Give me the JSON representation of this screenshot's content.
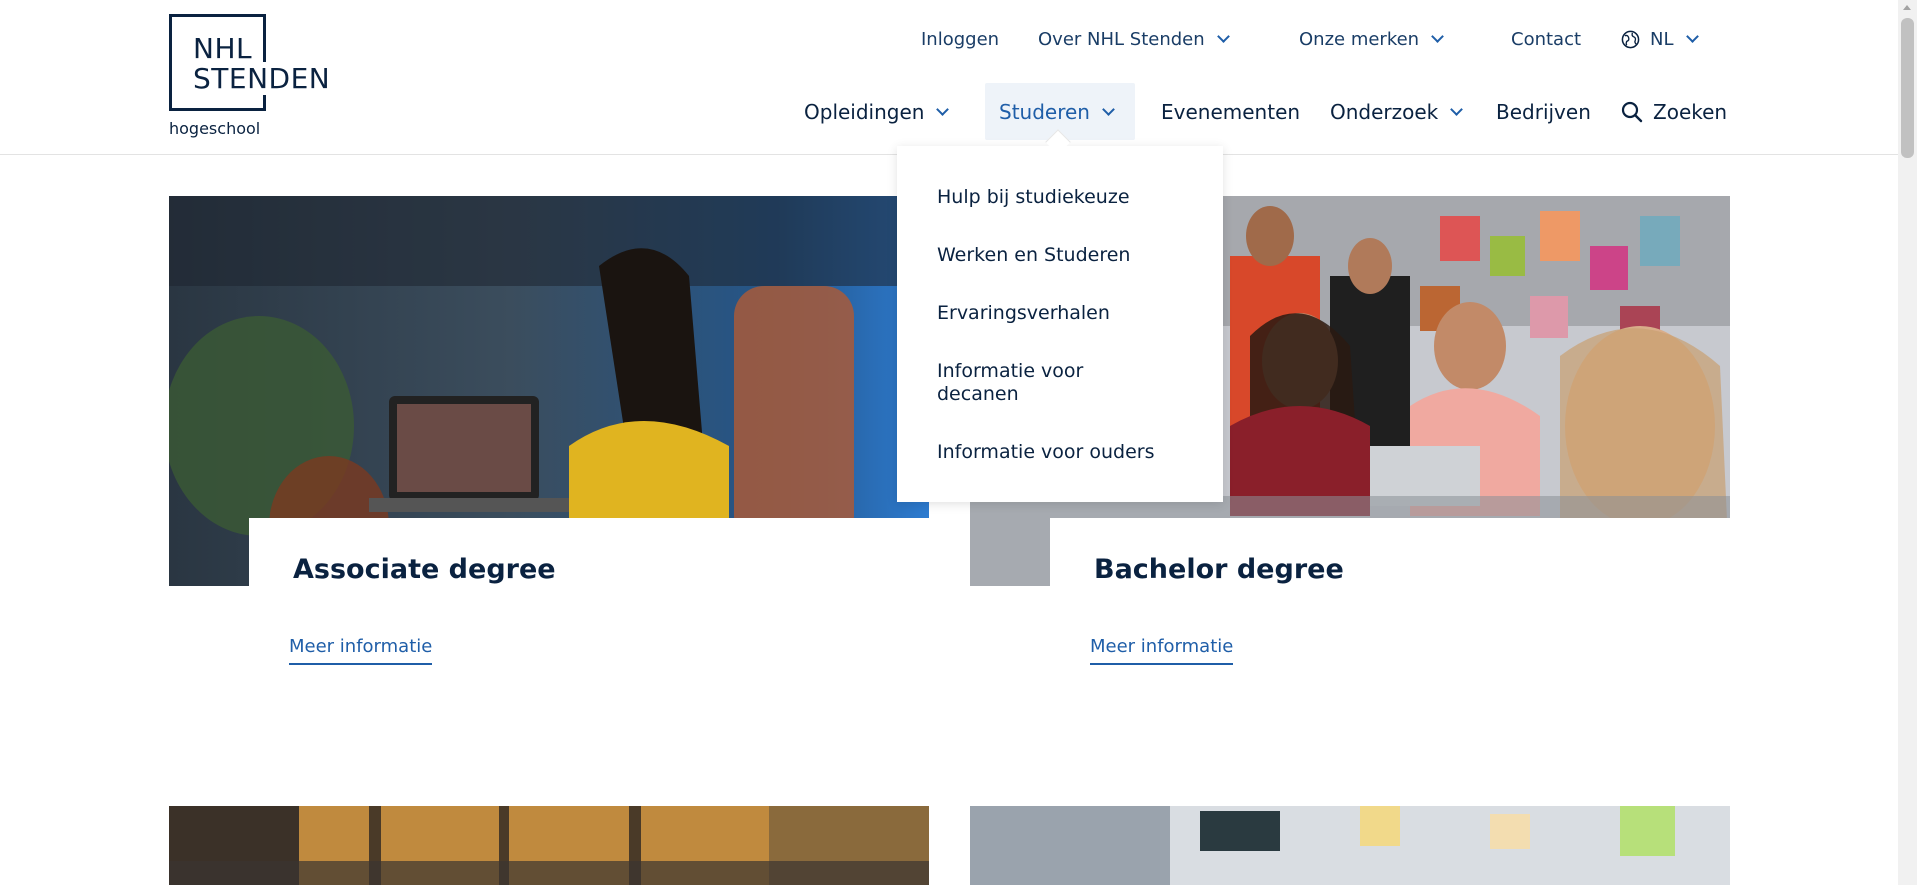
{
  "logo": {
    "line1": "NHL",
    "line2": "STENDEN",
    "subtitle": "hogeschool"
  },
  "top_nav": {
    "login": "Inloggen",
    "about": "Over NHL Stenden",
    "brands": "Onze merken",
    "contact": "Contact",
    "language": "NL"
  },
  "main_nav": {
    "programs": "Opleidingen",
    "studying": "Studeren",
    "events": "Evenementen",
    "research": "Onderzoek",
    "companies": "Bedrijven",
    "search": "Zoeken"
  },
  "dropdown": {
    "items": [
      "Hulp bij studiekeuze",
      "Werken en Studeren",
      "Ervaringsverhalen",
      "Informatie voor decanen",
      "Informatie voor ouders"
    ]
  },
  "cards": [
    {
      "title": "Associate degree",
      "link": "Meer informatie"
    },
    {
      "title": "Bachelor degree",
      "link": "Meer informatie"
    }
  ],
  "colors": {
    "navy": "#0a2240",
    "link_blue": "#1f5ea8",
    "active_bg": "#eef3f9"
  },
  "icons": [
    "globe-icon",
    "chevron-down-icon",
    "search-icon"
  ]
}
